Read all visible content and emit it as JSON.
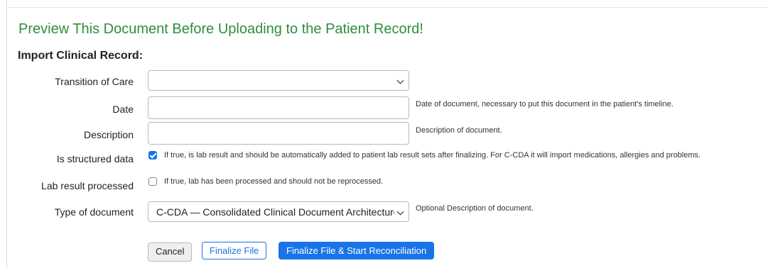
{
  "heading": "Preview This Document Before Uploading to the Patient Record!",
  "section_title": "Import Clinical Record:",
  "fields": {
    "transition": {
      "label": "Transition of Care",
      "value": ""
    },
    "date": {
      "label": "Date",
      "value": "",
      "help": "Date of document, necessary to put this document in the patient's timeline."
    },
    "description": {
      "label": "Description",
      "value": "",
      "help": "Description of document."
    },
    "structured": {
      "label": "Is structured data",
      "checked": true,
      "help": "If true, is lab result and should be automatically added to patient lab result sets after finalizing. For C-CDA it will import medications, allergies and problems."
    },
    "processed": {
      "label": "Lab result processed",
      "checked": false,
      "help": "If true, lab has been processed and should not be reprocessed."
    },
    "doc_type": {
      "label": "Type of document",
      "value": "C-CDA — Consolidated Clinical Document Architecture",
      "help": "Optional Description of document."
    }
  },
  "buttons": {
    "cancel": "Cancel",
    "finalize": "Finalize File",
    "reconcile": "Finalize File & Start Reconciliation"
  },
  "colors": {
    "heading": "#2f8d3c",
    "primary": "#1a73e8"
  }
}
